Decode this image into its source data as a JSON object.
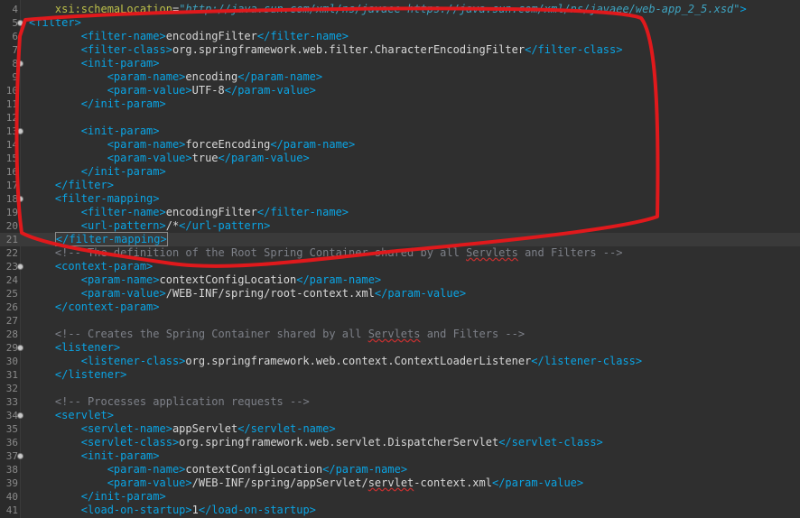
{
  "editor": {
    "lines": [
      {
        "n": "4",
        "fold": false,
        "current": false,
        "indent": "    ",
        "parts": [
          [
            "a",
            "xsi:schemaLocation"
          ],
          [
            "x",
            "="
          ],
          [
            "s",
            "\"http://java.sun.com/xml/ns/javaee https://java.sun.com/xml/ns/javaee/web-app_2_5.xsd\""
          ],
          [
            "t",
            ">"
          ]
        ]
      },
      {
        "n": "5",
        "fold": true,
        "current": false,
        "indent": "",
        "parts": [
          [
            "t",
            "<filter>"
          ]
        ]
      },
      {
        "n": "6",
        "fold": false,
        "current": false,
        "indent": "        ",
        "parts": [
          [
            "t",
            "<filter-name>"
          ],
          [
            "x",
            "encodingFilter"
          ],
          [
            "t",
            "</filter-name>"
          ]
        ]
      },
      {
        "n": "7",
        "fold": false,
        "current": false,
        "indent": "        ",
        "parts": [
          [
            "t",
            "<filter-class>"
          ],
          [
            "x",
            "org.springframework.web.filter.CharacterEncodingFilter"
          ],
          [
            "t",
            "</filter-class>"
          ]
        ]
      },
      {
        "n": "8",
        "fold": true,
        "current": false,
        "indent": "        ",
        "parts": [
          [
            "t",
            "<init-param>"
          ]
        ]
      },
      {
        "n": "9",
        "fold": false,
        "current": false,
        "indent": "            ",
        "parts": [
          [
            "t",
            "<param-name>"
          ],
          [
            "x",
            "encoding"
          ],
          [
            "t",
            "</param-name>"
          ]
        ]
      },
      {
        "n": "10",
        "fold": false,
        "current": false,
        "indent": "            ",
        "parts": [
          [
            "t",
            "<param-value>"
          ],
          [
            "x",
            "UTF-8"
          ],
          [
            "t",
            "</param-value>"
          ]
        ]
      },
      {
        "n": "11",
        "fold": false,
        "current": false,
        "indent": "        ",
        "parts": [
          [
            "t",
            "</init-param>"
          ]
        ]
      },
      {
        "n": "12",
        "fold": false,
        "current": false,
        "indent": "",
        "parts": []
      },
      {
        "n": "13",
        "fold": true,
        "current": false,
        "indent": "        ",
        "parts": [
          [
            "t",
            "<init-param>"
          ]
        ]
      },
      {
        "n": "14",
        "fold": false,
        "current": false,
        "indent": "            ",
        "parts": [
          [
            "t",
            "<param-name>"
          ],
          [
            "x",
            "forceEncoding"
          ],
          [
            "t",
            "</param-name>"
          ]
        ]
      },
      {
        "n": "15",
        "fold": false,
        "current": false,
        "indent": "            ",
        "parts": [
          [
            "t",
            "<param-value>"
          ],
          [
            "x",
            "true"
          ],
          [
            "t",
            "</param-value>"
          ]
        ]
      },
      {
        "n": "16",
        "fold": false,
        "current": false,
        "indent": "        ",
        "parts": [
          [
            "t",
            "</init-param>"
          ]
        ]
      },
      {
        "n": "17",
        "fold": false,
        "current": false,
        "indent": "    ",
        "parts": [
          [
            "t",
            "</filter>"
          ]
        ]
      },
      {
        "n": "18",
        "fold": true,
        "current": false,
        "indent": "    ",
        "parts": [
          [
            "t",
            "<filter-mapping>"
          ]
        ]
      },
      {
        "n": "19",
        "fold": false,
        "current": false,
        "indent": "        ",
        "parts": [
          [
            "t",
            "<filter-name>"
          ],
          [
            "x",
            "encodingFilter"
          ],
          [
            "t",
            "</filter-name>"
          ]
        ]
      },
      {
        "n": "20",
        "fold": false,
        "current": false,
        "indent": "        ",
        "parts": [
          [
            "t",
            "<url-pattern>"
          ],
          [
            "x",
            "/*"
          ],
          [
            "t",
            "</url-pattern>"
          ]
        ]
      },
      {
        "n": "21",
        "fold": false,
        "current": true,
        "indent": "    ",
        "parts": [
          [
            "t",
            "</filter-mapping>"
          ]
        ]
      },
      {
        "n": "22",
        "fold": false,
        "current": false,
        "indent": "    ",
        "parts": [
          [
            "c",
            "<!-- The definition of the Root Spring Container shared by all "
          ],
          [
            "cw",
            "Servlets"
          ],
          [
            "c",
            " and Filters -->"
          ]
        ]
      },
      {
        "n": "23",
        "fold": true,
        "current": false,
        "indent": "    ",
        "parts": [
          [
            "t",
            "<context-param>"
          ]
        ]
      },
      {
        "n": "24",
        "fold": false,
        "current": false,
        "indent": "        ",
        "parts": [
          [
            "t",
            "<param-name>"
          ],
          [
            "x",
            "contextConfigLocation"
          ],
          [
            "t",
            "</param-name>"
          ]
        ]
      },
      {
        "n": "25",
        "fold": false,
        "current": false,
        "indent": "        ",
        "parts": [
          [
            "t",
            "<param-value>"
          ],
          [
            "x",
            "/WEB-INF/spring/root-context.xml"
          ],
          [
            "t",
            "</param-value>"
          ]
        ]
      },
      {
        "n": "26",
        "fold": false,
        "current": false,
        "indent": "    ",
        "parts": [
          [
            "t",
            "</context-param>"
          ]
        ]
      },
      {
        "n": "27",
        "fold": false,
        "current": false,
        "indent": "",
        "parts": []
      },
      {
        "n": "28",
        "fold": false,
        "current": false,
        "indent": "    ",
        "parts": [
          [
            "c",
            "<!-- Creates the Spring Container shared by all "
          ],
          [
            "cw",
            "Servlets"
          ],
          [
            "c",
            " and Filters -->"
          ]
        ]
      },
      {
        "n": "29",
        "fold": true,
        "current": false,
        "indent": "    ",
        "parts": [
          [
            "t",
            "<listener>"
          ]
        ]
      },
      {
        "n": "30",
        "fold": false,
        "current": false,
        "indent": "        ",
        "parts": [
          [
            "t",
            "<listener-class>"
          ],
          [
            "x",
            "org.springframework.web.context.ContextLoaderListener"
          ],
          [
            "t",
            "</listener-class>"
          ]
        ]
      },
      {
        "n": "31",
        "fold": false,
        "current": false,
        "indent": "    ",
        "parts": [
          [
            "t",
            "</listener>"
          ]
        ]
      },
      {
        "n": "32",
        "fold": false,
        "current": false,
        "indent": "",
        "parts": []
      },
      {
        "n": "33",
        "fold": false,
        "current": false,
        "indent": "    ",
        "parts": [
          [
            "c",
            "<!-- Processes application requests -->"
          ]
        ]
      },
      {
        "n": "34",
        "fold": true,
        "current": false,
        "indent": "    ",
        "parts": [
          [
            "t",
            "<servlet>"
          ]
        ]
      },
      {
        "n": "35",
        "fold": false,
        "current": false,
        "indent": "        ",
        "parts": [
          [
            "t",
            "<servlet-name>"
          ],
          [
            "x",
            "appServlet"
          ],
          [
            "t",
            "</servlet-name>"
          ]
        ]
      },
      {
        "n": "36",
        "fold": false,
        "current": false,
        "indent": "        ",
        "parts": [
          [
            "t",
            "<servlet-class>"
          ],
          [
            "x",
            "org.springframework.web.servlet.DispatcherServlet"
          ],
          [
            "t",
            "</servlet-class>"
          ]
        ]
      },
      {
        "n": "37",
        "fold": true,
        "current": false,
        "indent": "        ",
        "parts": [
          [
            "t",
            "<init-param>"
          ]
        ]
      },
      {
        "n": "38",
        "fold": false,
        "current": false,
        "indent": "            ",
        "parts": [
          [
            "t",
            "<param-name>"
          ],
          [
            "x",
            "contextConfigLocation"
          ],
          [
            "t",
            "</param-name>"
          ]
        ]
      },
      {
        "n": "39",
        "fold": false,
        "current": false,
        "indent": "            ",
        "parts": [
          [
            "t",
            "<param-value>"
          ],
          [
            "x",
            "/WEB-INF/spring/appServlet/"
          ],
          [
            "xw",
            "servlet"
          ],
          [
            "x",
            "-context.xml"
          ],
          [
            "t",
            "</param-value>"
          ]
        ]
      },
      {
        "n": "40",
        "fold": false,
        "current": false,
        "indent": "        ",
        "parts": [
          [
            "t",
            "</init-param>"
          ]
        ]
      },
      {
        "n": "41",
        "fold": false,
        "current": false,
        "indent": "        ",
        "parts": [
          [
            "t",
            "<load-on-startup>"
          ],
          [
            "x",
            "1"
          ],
          [
            "t",
            "</load-on-startup>"
          ]
        ]
      }
    ]
  },
  "colors": {
    "background": "#2f2f2f",
    "tag": "#0aa4e4",
    "attribute": "#bcbf4a",
    "string": "#3ea3c0",
    "text": "#d8d8d8",
    "comment": "#7d8088",
    "annotation": "#e0191c"
  }
}
